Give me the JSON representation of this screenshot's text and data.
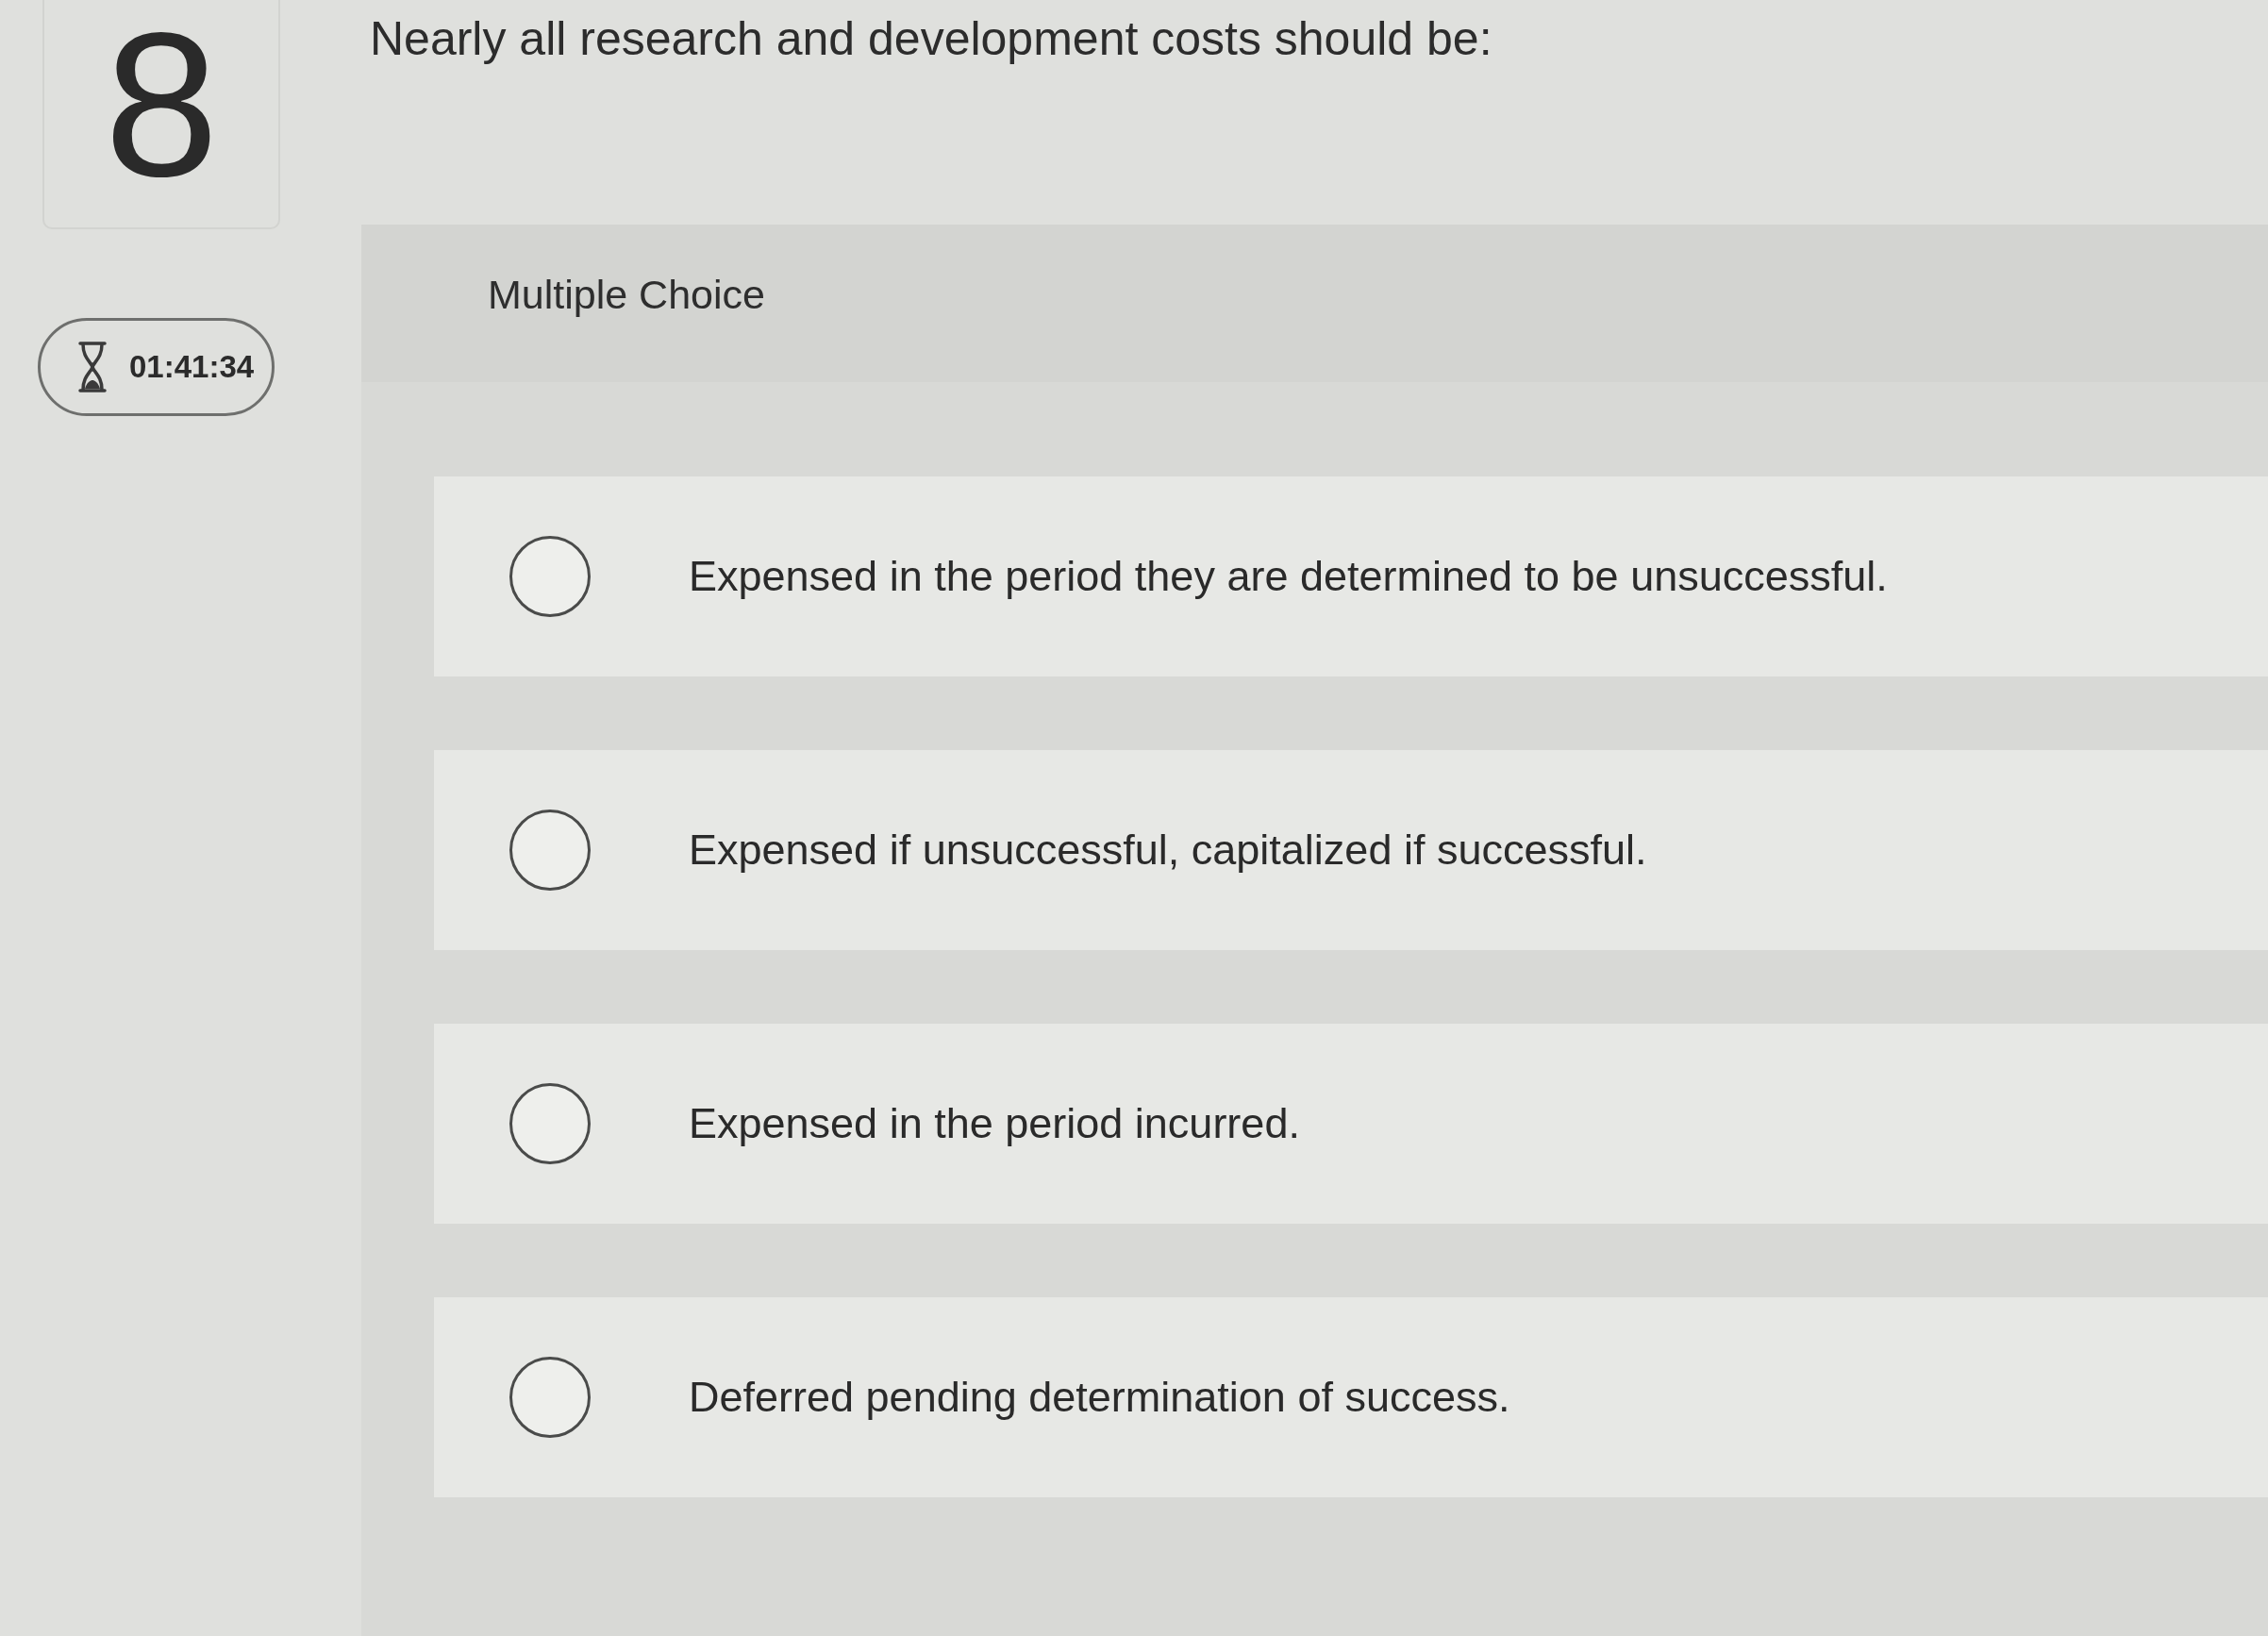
{
  "question": {
    "number": "8",
    "text": "Nearly all research and development costs should be:"
  },
  "timer": {
    "time": "01:41:34"
  },
  "answer": {
    "type_label": "Multiple Choice",
    "options": [
      {
        "text": "Expensed in the period they are determined to be unsuccessful.",
        "selected": false
      },
      {
        "text": "Expensed if unsuccessful, capitalized if successful.",
        "selected": false
      },
      {
        "text": "Expensed in the period incurred.",
        "selected": false
      },
      {
        "text": "Deferred pending determination of success.",
        "selected": false
      }
    ]
  }
}
